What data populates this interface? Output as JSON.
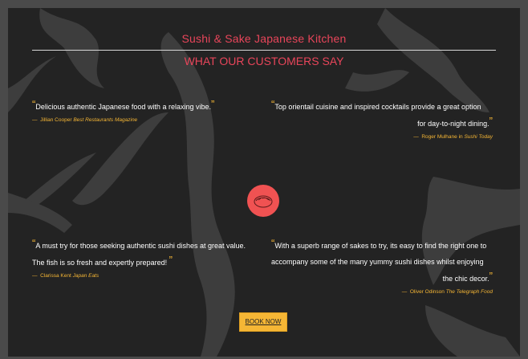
{
  "header": {
    "title": "Sushi & Sake Japanese Kitchen",
    "subtitle": "WHAT OUR CUSTOMERS SAY"
  },
  "testimonials": [
    {
      "lines": [
        "Delicious authentic Japanese food with a relaxing vibe."
      ],
      "author": "Jillian Cooper",
      "source": "Best Restaurants Magazine",
      "connector": ""
    },
    {
      "lines": [
        "Top orientail cuisine and inspired cocktails provide a great option",
        "for day-to-night dining."
      ],
      "author": "Roger Mulhane",
      "source": "Sushi Today",
      "connector": "in"
    },
    {
      "lines": [
        "A must try for those seeking authentic sushi dishes at great value.",
        "The fish is so fresh and expertly prepared!"
      ],
      "author": "Clarissa Kent",
      "source": "Japan Eats",
      "connector": ""
    },
    {
      "lines": [
        "With a superb range of sakes to try, its easy to find the right one to",
        "accompany some of the many yummy sushi dishes whilst enjoying",
        "the chic decor."
      ],
      "author": "Oliver Odinson",
      "source": "The Telegraph Food",
      "connector": ""
    }
  ],
  "quote_open": "“",
  "quote_close": "”",
  "cite_dash": "—",
  "cta": {
    "label": "BOOK NOW"
  },
  "colors": {
    "accent": "#e8455a",
    "gold": "#f5b635",
    "background": "#232323",
    "badge": "#f05252"
  },
  "icons": {
    "badge": "sushi-plate-icon",
    "background": "koi-fish-illustration"
  }
}
